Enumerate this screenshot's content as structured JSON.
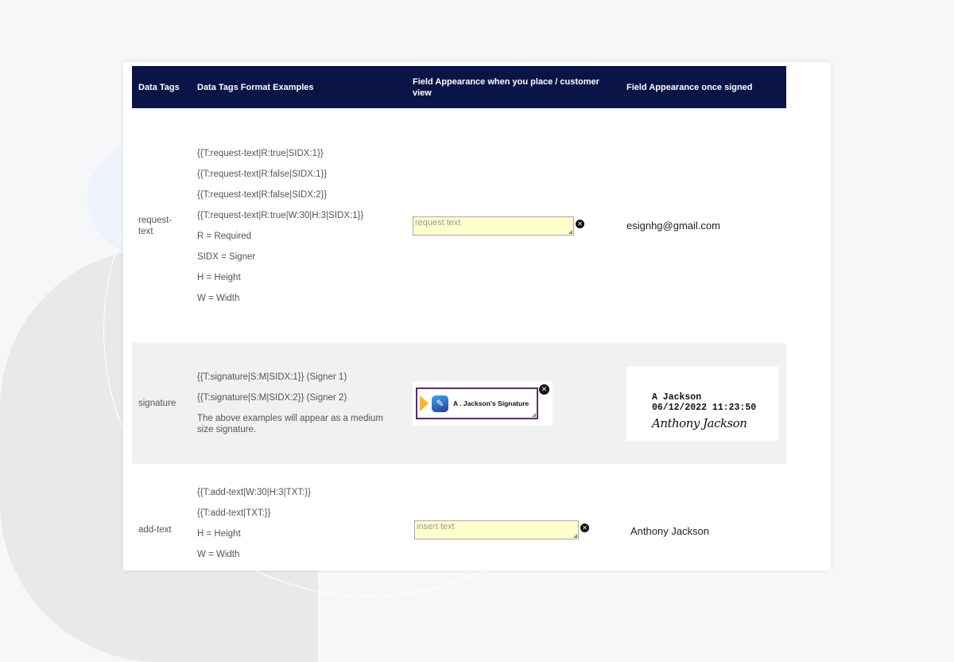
{
  "table": {
    "headers": [
      "Data Tags",
      "Data Tags Format Examples",
      "Field Appearance when you place / customer view",
      "Field Appearance once signed"
    ],
    "rows": [
      {
        "tag": "request-text",
        "formats": [
          "{{T:request-text|R:true|SIDX:1}}",
          "{{T:request-text|R:false|SIDX:1}}",
          "{{T:request-text|R:false|SIDX:2}}",
          "{{T:request-text|R:true|W:30|H:3|SIDX:1}}",
          "R = Required",
          "SIDX = Signer",
          "H = Height",
          "W = Width"
        ],
        "field_placeholder": "request text",
        "signed_value": "esignhg@gmail.com"
      },
      {
        "tag": "signature",
        "formats": [
          "{{T:signature|S:M|SIDX:1}} (Signer 1)",
          "{{T:signature|S:M|SIDX:2}} (Signer 2)",
          "The above examples will appear as a medium size signature."
        ],
        "field_label": "A . Jackson's Signature",
        "signed_name": "A Jackson",
        "signed_timestamp": "06/12/2022 11:23:50",
        "signed_script": "Anthony Jackson"
      },
      {
        "tag": "add-text",
        "formats": [
          "{{T:add-text|W:30|H:3|TXT:}}",
          "{{T:add-text|TXT:}}",
          "H = Height",
          "W = Width"
        ],
        "field_placeholder": "insert text",
        "signed_value": "Anthony Jackson"
      }
    ]
  },
  "icons": {
    "close": "✕",
    "signature_logo": "signature-pen"
  },
  "colors": {
    "header_bg": "#0b1447",
    "field_bg": "#ffffcc",
    "signature_border": "#5a2d6e",
    "signature_arrow": "#f5b82e"
  }
}
